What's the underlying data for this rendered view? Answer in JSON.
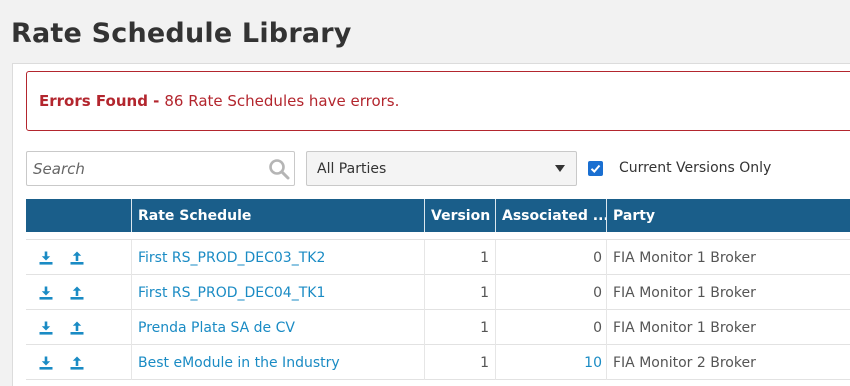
{
  "page": {
    "title": "Rate Schedule Library"
  },
  "error": {
    "strong": "Errors Found -",
    "message": "86 Rate Schedules have errors."
  },
  "filters": {
    "search_placeholder": "Search",
    "party_selected": "All Parties",
    "current_versions_label": "Current Versions Only",
    "current_versions_checked": true
  },
  "table": {
    "columns": [
      "Rate Schedule",
      "Version",
      "Associated ...",
      "Party"
    ],
    "rows": [
      {
        "name": "First RS_PROD_DEC03_TK2",
        "version": "1",
        "associated": "0",
        "associated_link": false,
        "party": "FIA Monitor 1 Broker"
      },
      {
        "name": "First RS_PROD_DEC04_TK1",
        "version": "1",
        "associated": "0",
        "associated_link": false,
        "party": "FIA Monitor 1 Broker"
      },
      {
        "name": "Prenda Plata SA de CV",
        "version": "1",
        "associated": "0",
        "associated_link": false,
        "party": "FIA Monitor 1 Broker"
      },
      {
        "name": "Best eModule in the Industry",
        "version": "1",
        "associated": "10",
        "associated_link": true,
        "party": "FIA Monitor 2 Broker"
      }
    ]
  },
  "icons": {
    "row_actions": [
      "download-icon",
      "upload-icon"
    ],
    "search": "search-icon"
  },
  "colors": {
    "header_bg": "#1a5e8a",
    "link": "#1a8bc4",
    "error": "#b3262e",
    "checkbox": "#1a6fd1"
  }
}
